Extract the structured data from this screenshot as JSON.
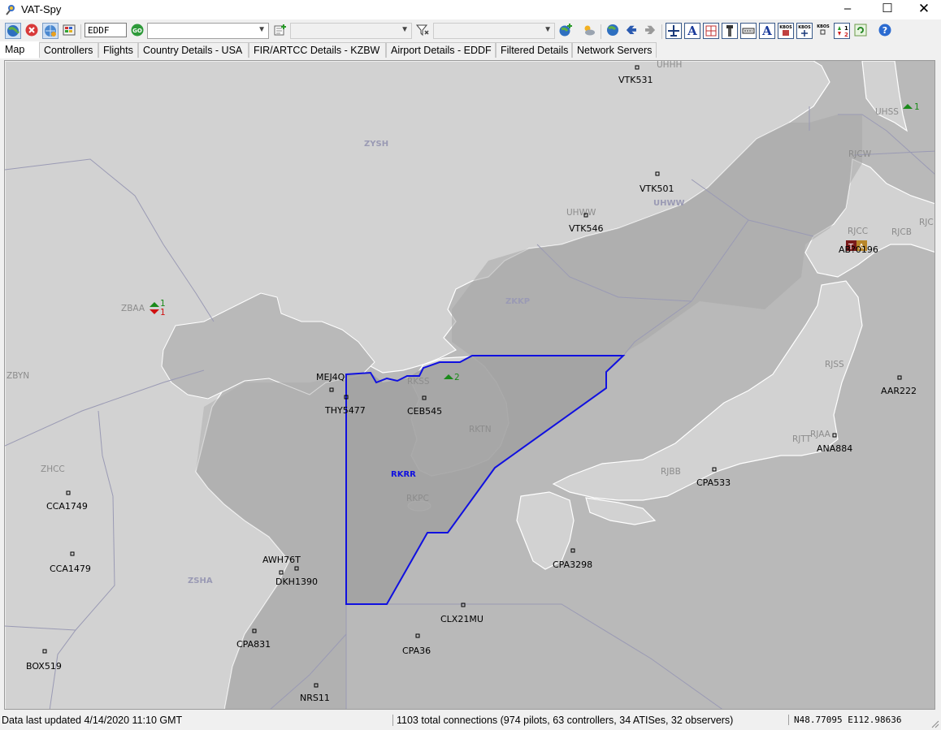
{
  "window": {
    "title": "VAT-Spy"
  },
  "toolbar": {
    "icao_value": "EDDF",
    "buttons": [
      {
        "name": "map-view-icon",
        "icon": "globe-map",
        "pressed": true
      },
      {
        "name": "disconnect-icon",
        "icon": "red-x-circle"
      },
      {
        "name": "connect-globe-icon",
        "icon": "globe-refresh",
        "pressed": true
      },
      {
        "name": "settings-icon",
        "icon": "palette"
      },
      {
        "name": "go-button",
        "icon": "go"
      }
    ],
    "combo1_value": "",
    "combo2_value": "",
    "combo3_value": "",
    "right_icons": [
      "flight-icon",
      "atis-icon",
      "fir-icon",
      "tower-icon",
      "runway-icon",
      "label-icon",
      "metar-icon",
      "metar-flight-icon",
      "metar-toggle-icon",
      "sort-icon",
      "refresh-icon",
      "help-icon"
    ]
  },
  "tabs": [
    {
      "label": "Map",
      "active": true
    },
    {
      "label": "Controllers"
    },
    {
      "label": "Flights"
    },
    {
      "label": "Country Details - USA"
    },
    {
      "label": "FIR/ARTCC Details - KZBW"
    },
    {
      "label": "Airport Details - EDDF"
    },
    {
      "label": "Filtered Details"
    },
    {
      "label": "Network Servers"
    }
  ],
  "map": {
    "colors": {
      "land": "#d2d2d2",
      "sea": "#b9b9b9",
      "fir_dark": "#a8a8a8",
      "selected": "#1010e0",
      "fir_label": "#9a9ab0",
      "airport": "#8c8c8c",
      "up": "#1a8a1a",
      "down": "#d01010"
    },
    "fir_labels": [
      "ZYSH",
      "UHWW",
      "ZKKP",
      "RKRR",
      "ZSHA"
    ],
    "airport_labels": [
      "UHHH",
      "UHSS",
      "RJCW",
      "UHWW",
      "RJCC",
      "RJCB",
      "RJC",
      "ZBAA",
      "ZBYN",
      "RKSS",
      "RKTN",
      "RKPC",
      "ZHCC",
      "RJSS",
      "RJAA",
      "RJTT",
      "RJBB"
    ],
    "flights": [
      "VTK531",
      "VTK501",
      "VTK546",
      "AB?0196",
      "MEJ4Q",
      "THY5477",
      "CEB545",
      "AAR222",
      "ANA884",
      "CPA533",
      "CCA1749",
      "CCA1479",
      "AWH76T",
      "DKH1390",
      "CPA3298",
      "CLX21MU",
      "CPA831",
      "CPA36",
      "BOX519",
      "NRS11"
    ],
    "counters": {
      "uhss_up": "1",
      "zbaa_up": "1",
      "zbaa_down": "1",
      "rkss_up": "2"
    },
    "atis_badge": [
      "T",
      "A"
    ]
  },
  "status": {
    "updated": "Data last updated 4/14/2020 11:10 GMT",
    "connections": "1103 total connections (974 pilots, 63 controllers, 34 ATISes, 32 observers)",
    "coords": "N48.77095  E112.98636"
  }
}
